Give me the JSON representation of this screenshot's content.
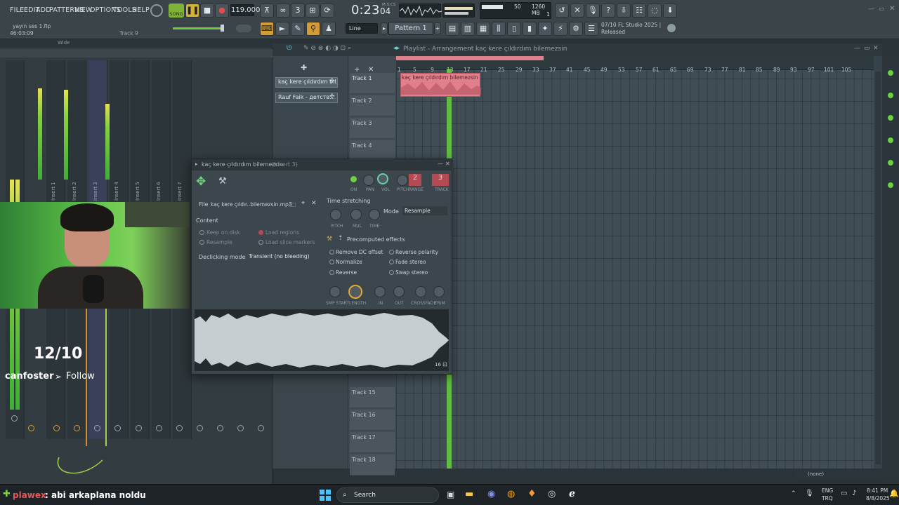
{
  "menu": [
    "FILE",
    "EDIT",
    "ADD",
    "PATTERNS",
    "VIEW",
    "OPTIONS",
    "TOOLS",
    "HELP"
  ],
  "project": {
    "file": "yayın ses 1.flp",
    "time": "46:03:09",
    "track": "Track 9"
  },
  "transport": {
    "mode": "SONG",
    "tempo": "119.000",
    "time_main": "0:23",
    "time_sub": "04",
    "time_unit": "M:S:CS"
  },
  "cpu": {
    "value": "50",
    "memory": "1260 MB",
    "poly": "1"
  },
  "snap": "Line",
  "pattern_name": "Pattern 1",
  "news": {
    "line1": "07/10  FL Studio 2025 |",
    "line2": "Released"
  },
  "mixer": {
    "wide_label": "Wide",
    "strips": [
      "Master",
      "Insert 1",
      "Insert 2",
      "Insert 3",
      "Insert 4",
      "Insert 5",
      "Insert 6",
      "Insert 7"
    ],
    "meter_levels": [
      0.6,
      0.88,
      0.84,
      0.81
    ]
  },
  "stream": {
    "counter": "12/10",
    "user": "canfoster",
    "follow": "Follow",
    "chat_user": "plawex",
    "chat_text": ": abi arkaplana noldu"
  },
  "playlist": {
    "title": "Playlist - Arrangement",
    "breadcrumb": "kaç kere çıldırdım bilemezsin",
    "patterns": [
      "kaç kere çıldırdım bil...",
      "Rauf Faik - детств..."
    ],
    "tracks_top": [
      "Track 1",
      "Track 2",
      "Track 3",
      "Track 4"
    ],
    "tracks_bottom": [
      "Track 15",
      "Track 16",
      "Track 17",
      "Track 18"
    ],
    "bars": [
      "5",
      "9",
      "13",
      "17",
      "21",
      "25",
      "29",
      "33",
      "37",
      "41",
      "45",
      "49",
      "53",
      "57",
      "61",
      "65",
      "69",
      "73",
      "77",
      "81",
      "85",
      "89",
      "93",
      "97",
      "101",
      "105"
    ],
    "bar_first": "1",
    "clip_label": "kaç kere çıldırdım bilemezsin",
    "status": "(none)"
  },
  "channel": {
    "title": "kaç kere çıldırdım bilemezsin",
    "insert": "(Insert 3)",
    "knob_labels": [
      "ON",
      "PAN",
      "VOL",
      "PITCH",
      "RANGE",
      "TRACK"
    ],
    "range_value": "2",
    "track_value": "3",
    "file_label": "File",
    "file_name": "kaç kere çıldır..bilemezsin.mp3",
    "content_label": "Content",
    "content_options": [
      "Keep on disk",
      "Load regions",
      "Resample",
      "Load slice markers"
    ],
    "declicking_label": "Declicking mode",
    "declicking_value": "Transient (no bleeding)",
    "time_stretching": "Time stretching",
    "ts_knobs": [
      "PITCH",
      "MUL",
      "TIME"
    ],
    "mode_label": "Mode",
    "mode_value": "Resample",
    "precomputed": "Precomputed effects",
    "effects": [
      "Remove DC offset",
      "Reverse polarity",
      "Normalize",
      "Fade stereo",
      "Reverse",
      "Swap stereo"
    ],
    "effect_knobs": [
      "SMP START",
      "LENGTH",
      "IN",
      "OUT",
      "CROSSFADE",
      "TRIM"
    ],
    "wave_count": "16"
  },
  "taskbar": {
    "search": "Search",
    "lang1": "ENG",
    "lang2": "TRQ",
    "time": "8:41 PM",
    "date": "8/8/2025"
  },
  "colors": {
    "accent": "#e8a93a",
    "meter": "#84d23b",
    "clip": "#e17f8c",
    "playhead": "#69d13f"
  }
}
